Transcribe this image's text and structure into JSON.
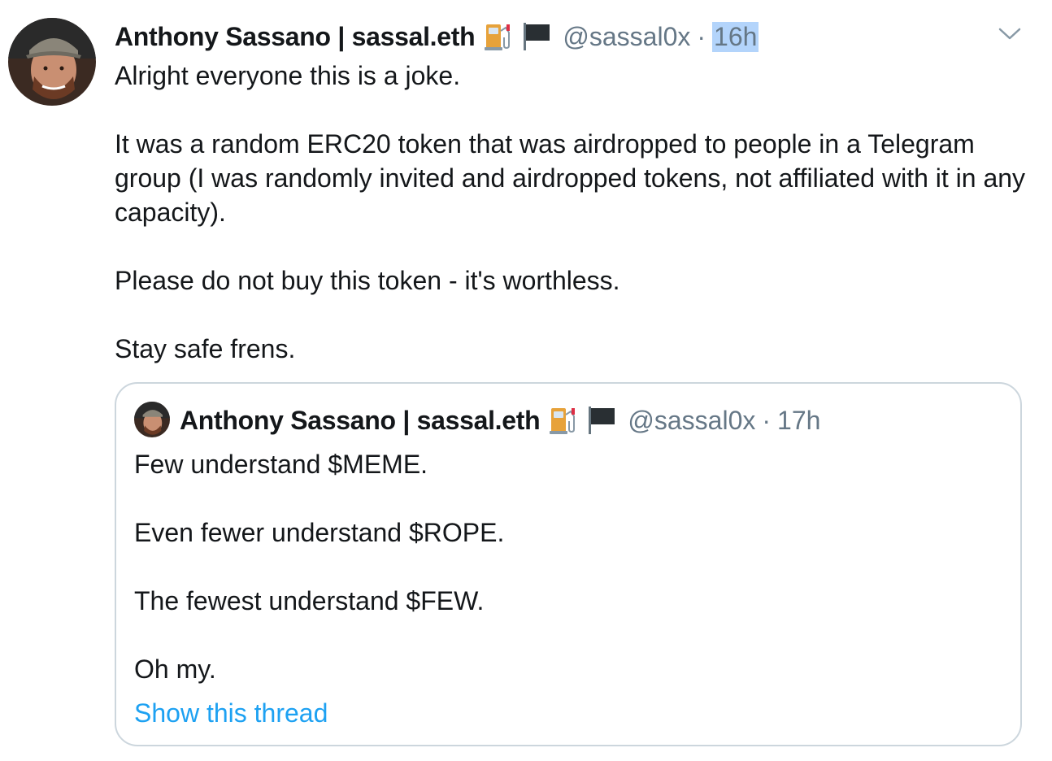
{
  "tweet": {
    "author_name": "Anthony Sassano | sassal.eth",
    "name_emojis": [
      "fuel-pump-icon",
      "black-flag-icon"
    ],
    "handle": "@sassal0x",
    "separator": "·",
    "time": "16h",
    "paragraphs": [
      "Alright everyone this is a joke.",
      "It was a random ERC20 token that was airdropped to people in a Telegram group (I was randomly invited and airdropped tokens, not affiliated with it in any capacity).",
      "Please do not buy this token - it's worthless.",
      "Stay safe frens."
    ],
    "menu_icon": "chevron-down-icon"
  },
  "quoted_tweet": {
    "author_name": "Anthony Sassano | sassal.eth",
    "name_emojis": [
      "fuel-pump-icon",
      "black-flag-icon"
    ],
    "handle": "@sassal0x",
    "separator": "·",
    "time": "17h",
    "paragraphs": [
      "Few understand $MEME.",
      "Even fewer understand $ROPE.",
      "The fewest understand $FEW.",
      "Oh my."
    ],
    "thread_link": "Show this thread"
  },
  "colors": {
    "text": "#14171a",
    "secondary": "#657786",
    "link": "#1da1f2",
    "border": "#ccd6dd",
    "selection": "#b3d4fb"
  }
}
